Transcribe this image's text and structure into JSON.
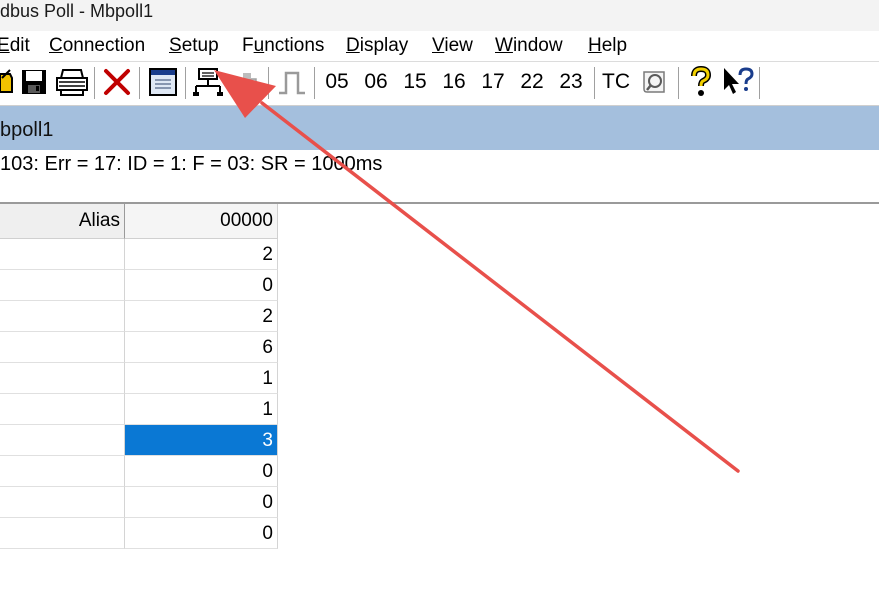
{
  "window": {
    "title": "dbus Poll - Mbpoll1"
  },
  "menu": {
    "items": [
      {
        "pre": "",
        "u": "E",
        "post": "dit"
      },
      {
        "pre": "",
        "u": "C",
        "post": "onnection"
      },
      {
        "pre": "",
        "u": "S",
        "post": "etup"
      },
      {
        "pre": "F",
        "u": "u",
        "post": "nctions"
      },
      {
        "pre": "",
        "u": "D",
        "post": "isplay"
      },
      {
        "pre": "",
        "u": "V",
        "post": "iew"
      },
      {
        "pre": "",
        "u": "W",
        "post": "indow"
      },
      {
        "pre": "",
        "u": "H",
        "post": "elp"
      }
    ]
  },
  "toolbar": {
    "function_codes": [
      "05",
      "06",
      "15",
      "16",
      "17",
      "22",
      "23"
    ],
    "tc_label": "TC"
  },
  "document": {
    "title": "bpoll1",
    "status": "103: Err = 17: ID = 1: F = 03: SR = 1000ms"
  },
  "table": {
    "alias_header": "Alias",
    "column_header": "00000",
    "values": [
      "2",
      "0",
      "2",
      "6",
      "1",
      "1",
      "3",
      "0",
      "0",
      "0"
    ],
    "selected_index": 6
  },
  "colors": {
    "selection": "#0a78d4",
    "doc_title_bar": "#a4bfdd",
    "annotation_arrow": "#e8504b"
  }
}
